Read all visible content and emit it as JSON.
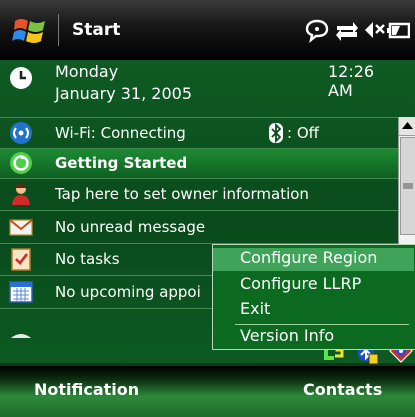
{
  "title_bar": {
    "title": "Start",
    "icons": [
      "windows-start-flag-icon",
      "speech-bubble-icon",
      "connectivity-arrows-icon",
      "speaker-muted-icon",
      "battery-icon"
    ]
  },
  "today": {
    "date": {
      "day": "Monday",
      "date": "January 31, 2005",
      "time": "12:26 AM"
    },
    "wifi": {
      "label": "Wi-Fi: Connecting",
      "bluetooth_status": ": Off"
    },
    "getting_started": "Getting Started",
    "owner": "Tap here to set owner information",
    "messages": "No unread message",
    "tasks": "No tasks",
    "appointments": "No upcoming appoi"
  },
  "context_menu": {
    "items": [
      "Configure Region",
      "Configure LLRP",
      "Exit",
      "Version Info"
    ],
    "selected": "Configure Region"
  },
  "tray": {
    "icons": [
      "ls-app-icon",
      "bluetooth-tray-icon",
      "network-tray-icon"
    ]
  },
  "softkeys": {
    "left": "Notification",
    "right": "Contacts"
  },
  "colors": {
    "accent": "#1d8a33",
    "menu_bg": "#0c6a20",
    "menu_selected": "#3fa35a"
  }
}
